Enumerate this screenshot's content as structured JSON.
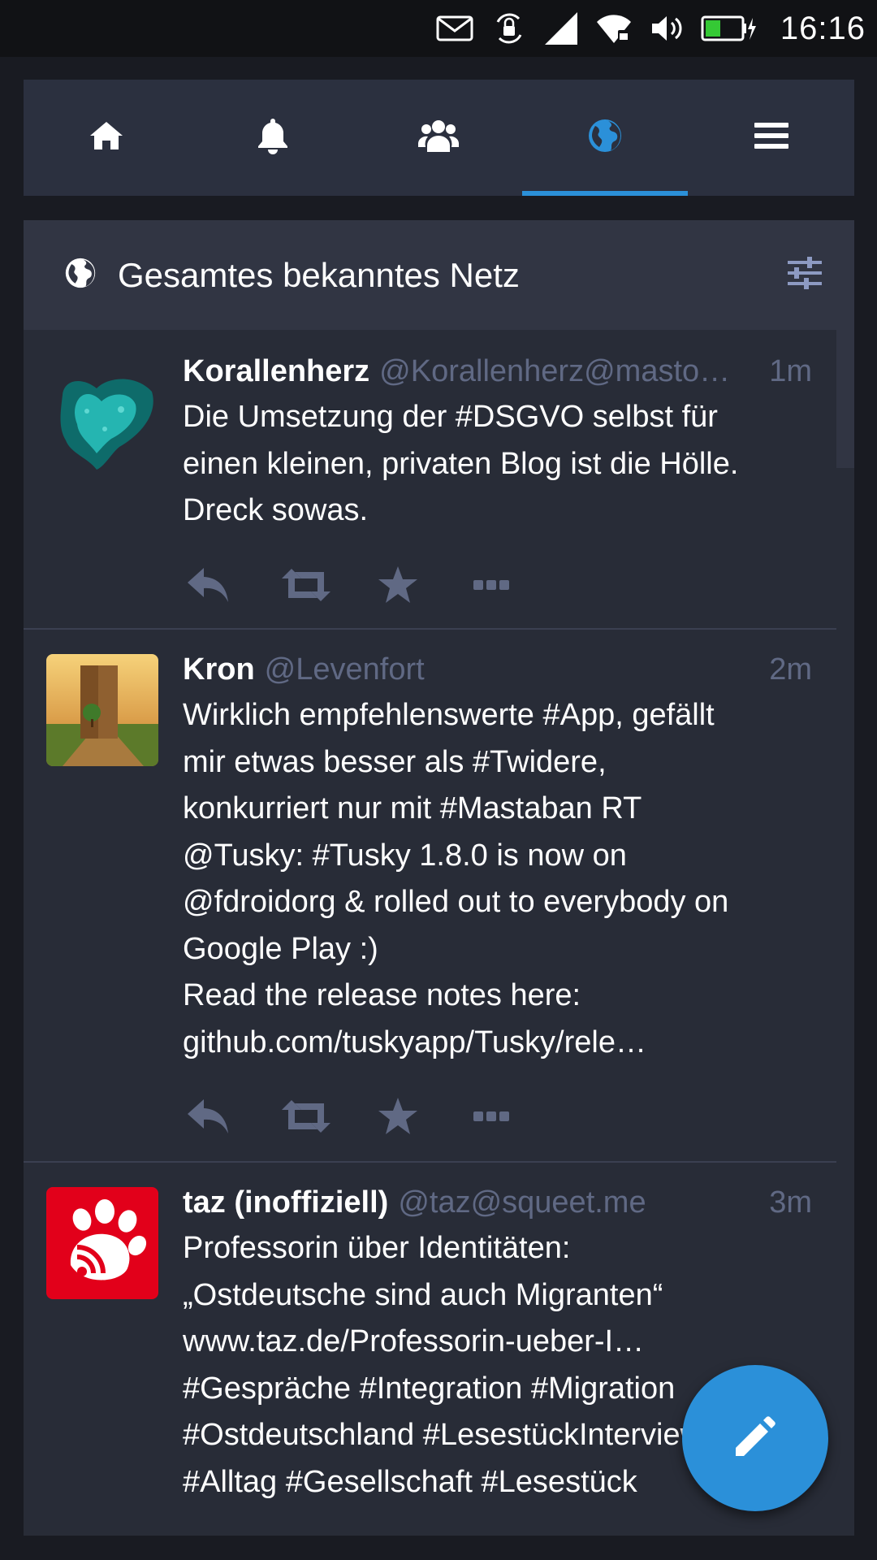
{
  "statusbar": {
    "time": "16:16",
    "icons": [
      "mail-icon",
      "rotation-lock-icon",
      "cell-signal-icon",
      "wifi-icon",
      "volume-icon",
      "battery-charging-icon"
    ]
  },
  "tabs": [
    {
      "name": "home",
      "icon": "home-icon",
      "active": false
    },
    {
      "name": "notifications",
      "icon": "bell-icon",
      "active": false
    },
    {
      "name": "local",
      "icon": "users-icon",
      "active": false
    },
    {
      "name": "federated",
      "icon": "globe-icon",
      "active": true
    },
    {
      "name": "menu",
      "icon": "hamburger-icon",
      "active": false
    }
  ],
  "column": {
    "title": "Gesamtes bekanntes Netz",
    "icon": "globe-icon",
    "settings_icon": "sliders-icon"
  },
  "statuses": [
    {
      "name": "Korallenherz",
      "handle": "@Korallenherz@masto…",
      "time": "1m",
      "lines": [
        "Die Umsetzung der #DSGVO selbst für",
        "einen kleinen, privaten Blog ist die Hölle.",
        "Dreck sowas."
      ]
    },
    {
      "name": "Kron",
      "handle": "@Levenfort",
      "time": "2m",
      "lines": [
        "Wirklich empfehlenswerte #App, gefällt",
        "mir etwas besser als #Twidere,",
        "konkurriert nur mit #Mastaban  RT",
        "@Tusky: #Tusky 1.8.0 is now on",
        "@fdroidorg & rolled out to everybody on",
        "Google Play :)",
        "Read the release notes here:",
        "github.com/tuskyapp/Tusky/rele…"
      ]
    },
    {
      "name": "taz (inoffiziell)",
      "handle": "@taz@squeet.me",
      "time": "3m",
      "lines": [
        "Professorin über Identitäten:",
        "„Ostdeutsche sind auch Migranten“",
        "www.taz.de/Professorin-ueber-I…",
        "#Gespräche #Integration #Migration",
        "#Ostdeutschland #LesestückInterview",
        "#Alltag #Gesellschaft #Lesestück"
      ]
    }
  ],
  "actions": [
    "reply-icon",
    "boost-icon",
    "favourite-icon",
    "more-icon"
  ],
  "fab": {
    "icon": "pencil-icon"
  },
  "colors": {
    "accent": "#2b90d9",
    "background": "#191b22",
    "panel": "#282c37",
    "header": "#313543",
    "muted": "#606984"
  }
}
